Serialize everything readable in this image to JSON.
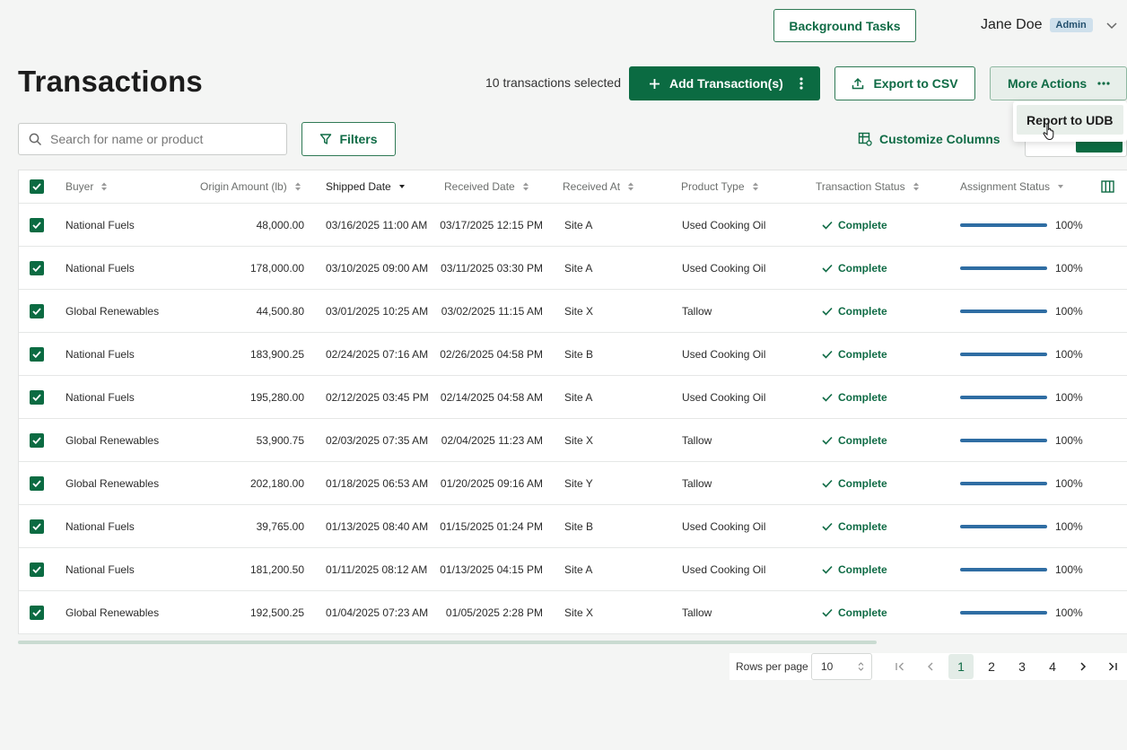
{
  "header": {
    "background_tasks_label": "Background Tasks",
    "user_name": "Jane Doe",
    "user_role": "Admin"
  },
  "page": {
    "title": "Transactions",
    "selected_count_text": "10 transactions selected"
  },
  "actions": {
    "add_label": "Add Transaction(s)",
    "export_label": "Export to CSV",
    "more_label": "More Actions",
    "more_menu": [
      {
        "label": "Report to UDB"
      }
    ]
  },
  "toolbar": {
    "search_placeholder": "Search for name or product",
    "filters_label": "Filters",
    "customize_label": "Customize Columns"
  },
  "table": {
    "columns": [
      {
        "label": "Buyer"
      },
      {
        "label": "Origin Amount (lb)"
      },
      {
        "label": "Shipped Date"
      },
      {
        "label": "Received Date"
      },
      {
        "label": "Received At"
      },
      {
        "label": "Product Type"
      },
      {
        "label": "Transaction Status"
      },
      {
        "label": "Assignment Status"
      }
    ],
    "rows": [
      {
        "buyer": "National Fuels",
        "amount": "48,000.00",
        "shipped": "03/16/2025 11:00 AM",
        "received": "03/17/2025 12:15 PM",
        "site": "Site A",
        "product": "Used Cooking Oil",
        "status": "Complete",
        "assignment": "100%",
        "assignment_fraction": 1.0
      },
      {
        "buyer": "National Fuels",
        "amount": "178,000.00",
        "shipped": "03/10/2025 09:00 AM",
        "received": "03/11/2025 03:30 PM",
        "site": "Site A",
        "product": "Used Cooking Oil",
        "status": "Complete",
        "assignment": "100%",
        "assignment_fraction": 1.0
      },
      {
        "buyer": "Global Renewables",
        "amount": "44,500.80",
        "shipped": "03/01/2025 10:25 AM",
        "received": "03/02/2025 11:15 AM",
        "site": "Site X",
        "product": "Tallow",
        "status": "Complete",
        "assignment": "100%",
        "assignment_fraction": 1.0
      },
      {
        "buyer": "National Fuels",
        "amount": "183,900.25",
        "shipped": "02/24/2025 07:16 AM",
        "received": "02/26/2025 04:58 PM",
        "site": "Site B",
        "product": "Used Cooking Oil",
        "status": "Complete",
        "assignment": "100%",
        "assignment_fraction": 1.0
      },
      {
        "buyer": "National Fuels",
        "amount": "195,280.00",
        "shipped": "02/12/2025 03:45 PM",
        "received": "02/14/2025 04:58 AM",
        "site": "Site A",
        "product": "Used Cooking Oil",
        "status": "Complete",
        "assignment": "100%",
        "assignment_fraction": 1.0
      },
      {
        "buyer": "Global Renewables",
        "amount": "53,900.75",
        "shipped": "02/03/2025 07:35 AM",
        "received": "02/04/2025 11:23 AM",
        "site": "Site X",
        "product": "Tallow",
        "status": "Complete",
        "assignment": "100%",
        "assignment_fraction": 1.0
      },
      {
        "buyer": "Global Renewables",
        "amount": "202,180.00",
        "shipped": "01/18/2025 06:53 AM",
        "received": "01/20/2025 09:16 AM",
        "site": "Site Y",
        "product": "Tallow",
        "status": "Complete",
        "assignment": "100%",
        "assignment_fraction": 1.0
      },
      {
        "buyer": "National Fuels",
        "amount": "39,765.00",
        "shipped": "01/13/2025 08:40 AM",
        "received": "01/15/2025 01:24 PM",
        "site": "Site B",
        "product": "Used Cooking Oil",
        "status": "Complete",
        "assignment": "100%",
        "assignment_fraction": 1.0
      },
      {
        "buyer": "National Fuels",
        "amount": "181,200.50",
        "shipped": "01/11/2025 08:12 AM",
        "received": "01/13/2025 04:15 PM",
        "site": "Site A",
        "product": "Used Cooking Oil",
        "status": "Complete",
        "assignment": "100%",
        "assignment_fraction": 1.0
      },
      {
        "buyer": "Global Renewables",
        "amount": "192,500.25",
        "shipped": "01/04/2025 07:23 AM",
        "received": "01/05/2025 2:28 PM",
        "site": "Site X",
        "product": "Tallow",
        "status": "Complete",
        "assignment": "100%",
        "assignment_fraction": 1.0
      }
    ]
  },
  "pagination": {
    "rows_per_page_label": "Rows per page",
    "rows_per_page_value": "10",
    "pages": [
      "1",
      "2",
      "3",
      "4"
    ],
    "current_page": "1"
  },
  "colors": {
    "primary": "#0b6b42",
    "progress": "#2f6da3",
    "badge_bg": "#cfe0ec"
  }
}
